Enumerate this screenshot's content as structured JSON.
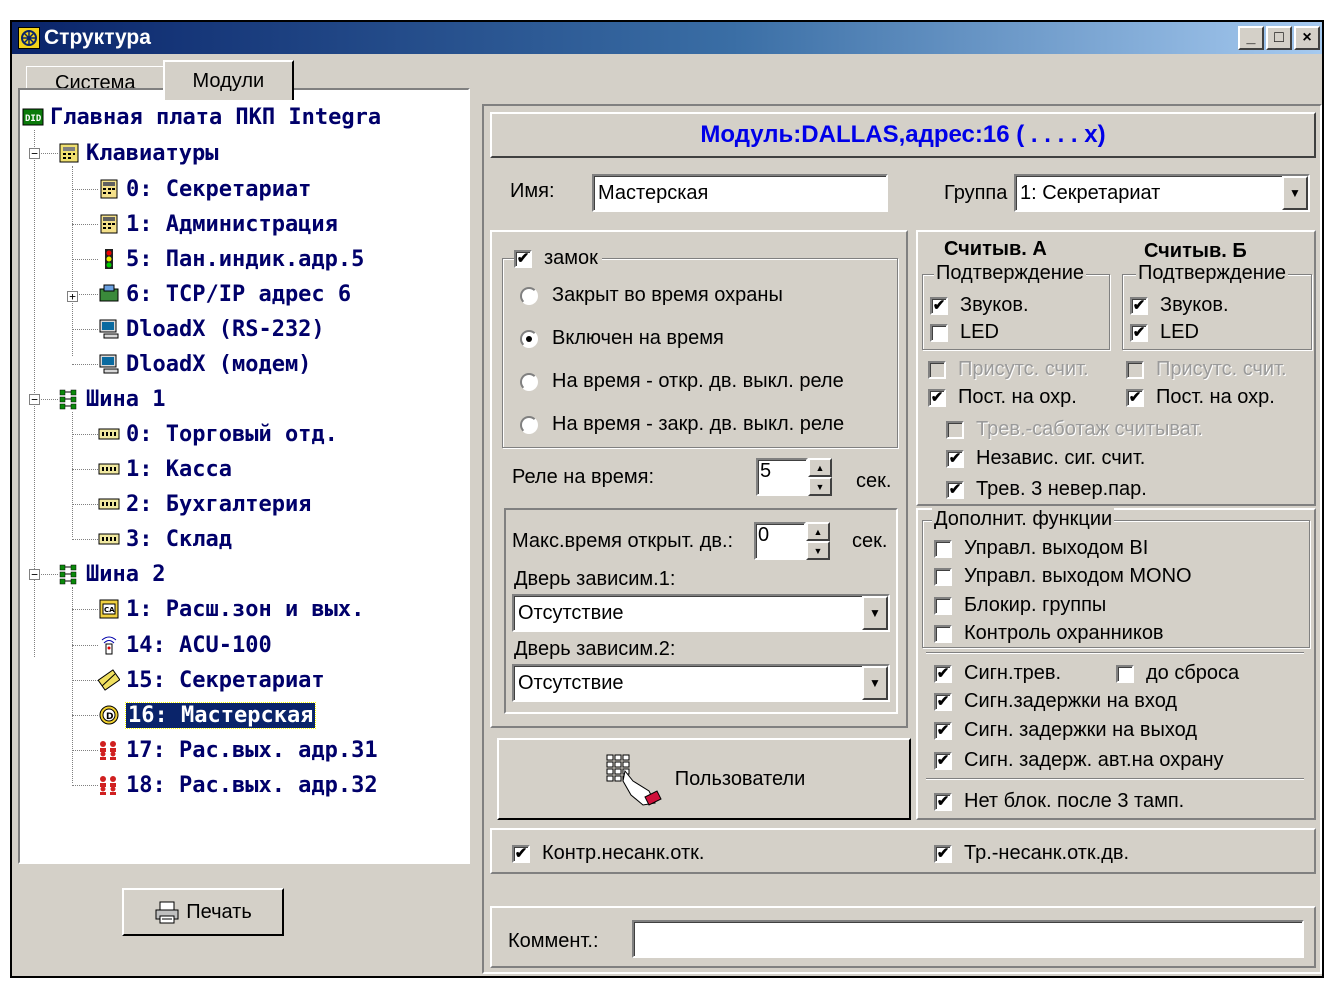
{
  "window": {
    "title": "Структура",
    "buttons": [
      "_",
      "□",
      "×"
    ]
  },
  "tabs": [
    {
      "label": "Система"
    },
    {
      "label": "Модули"
    }
  ],
  "tree": {
    "items": [
      {
        "label": "Главная плата ПКП Integra",
        "icon": "mainboard-icon"
      },
      {
        "label": "Клавиатуры",
        "icon": "keypad-group-icon"
      },
      {
        "label": "0: Секретариат",
        "icon": "keypad-icon"
      },
      {
        "label": "1: Администрация",
        "icon": "keypad-icon"
      },
      {
        "label": "5: Пан.индик.адр.5",
        "icon": "traffic-light-icon"
      },
      {
        "label": "6: TCP/IP адрес 6",
        "icon": "network-module-icon"
      },
      {
        "label": "DloadX (RS-232)",
        "icon": "computer-icon"
      },
      {
        "label": "DloadX (модем)",
        "icon": "computer-icon"
      },
      {
        "label": "Шина 1",
        "icon": "bus-icon"
      },
      {
        "label": "0: Торговый отд.",
        "icon": "expander-icon"
      },
      {
        "label": "1: Касса",
        "icon": "expander-icon"
      },
      {
        "label": "2: Бухгалтерия",
        "icon": "expander-icon"
      },
      {
        "label": "3: Склад",
        "icon": "expander-icon"
      },
      {
        "label": "Шина 2",
        "icon": "bus-icon"
      },
      {
        "label": "1: Расш.зон и вых.",
        "icon": "zone-expander-icon"
      },
      {
        "label": "14: ACU-100",
        "icon": "wireless-icon"
      },
      {
        "label": "15: Секретариат",
        "icon": "card-reader-icon"
      },
      {
        "label": "16: Мастерская",
        "icon": "dallas-icon",
        "selected": true
      },
      {
        "label": "17: Рас.вых. адр.31",
        "icon": "output-expander-icon"
      },
      {
        "label": "18: Рас.вых. адр.32",
        "icon": "output-expander-icon"
      }
    ]
  },
  "print_button": {
    "label": "Печать"
  },
  "module": {
    "header": "Модуль:DALLAS,адрес:16 ( . . . . x)",
    "name_label": "Имя:",
    "name_value": "Мастерская",
    "group_label": "Группа",
    "group_value": "1: Секретариат",
    "lock": {
      "label": "замок",
      "checked": true,
      "options": [
        {
          "label": "Закрыт во время охраны",
          "selected": false
        },
        {
          "label": "Включен на время",
          "selected": true
        },
        {
          "label": "На время - откр. дв. выкл. реле",
          "selected": false
        },
        {
          "label": "На время - закр. дв. выкл. реле",
          "selected": false
        }
      ]
    },
    "relay_label": "Реле на время:",
    "relay_value": "5",
    "relay_unit": "сек.",
    "max_open_label": "Макс.время открыт. дв.:",
    "max_open_value": "0",
    "max_open_unit": "сек.",
    "door1_label": "Дверь зависим.1:",
    "door1_value": "Отсутствие",
    "door2_label": "Дверь зависим.2:",
    "door2_value": "Отсутствие",
    "users_button": "Пользователи",
    "reader_a": {
      "title": "Считыв. А",
      "confirm": "Подтверждение",
      "sound": "Звуков.",
      "sound_checked": true,
      "led": "LED",
      "led_checked": false,
      "presence": "Присутс. счит.",
      "post": "Пост. на охр.",
      "post_checked": true
    },
    "reader_b": {
      "title": "Считыв. Б",
      "confirm": "Подтверждение",
      "sound": "Звуков.",
      "sound_checked": true,
      "led": "LED",
      "led_checked": true,
      "presence": "Присутс. счит.",
      "post": "Пост. на охр.",
      "post_checked": true
    },
    "tamper": "Трев.-саботаж считыват.",
    "independent": "Независ. сиг. счит.",
    "alarm3": "Трев. 3 невер.пар.",
    "extra_title": "Дополнит. функции",
    "extra": [
      {
        "label": "Управл. выходом BI",
        "checked": false
      },
      {
        "label": "Управл. выходом MONO",
        "checked": false
      },
      {
        "label": "Блокир. группы",
        "checked": false
      },
      {
        "label": "Контроль охранников",
        "checked": false
      }
    ],
    "signal_alarm": "Сигн.трев.",
    "until_reset": "до сброса",
    "signals": [
      {
        "label": "Сигн.задержки на вход",
        "checked": true
      },
      {
        "label": "Сигн. задержки на выход",
        "checked": true
      },
      {
        "label": "Сигн. задерж. авт.на охрану",
        "checked": true
      }
    ],
    "no_block": "Нет блок. после 3 тамп.",
    "unauth_control": "Контр.несанк.отк.",
    "unauth_alarm": "Тр.-несанк.отк.дв.",
    "comment_label": "Коммент.:",
    "comment_value": ""
  },
  "colors": {
    "selection": "#0a246a",
    "header_text": "#0000e8",
    "tree_text": "#00006a",
    "face": "#d4d0c8"
  }
}
